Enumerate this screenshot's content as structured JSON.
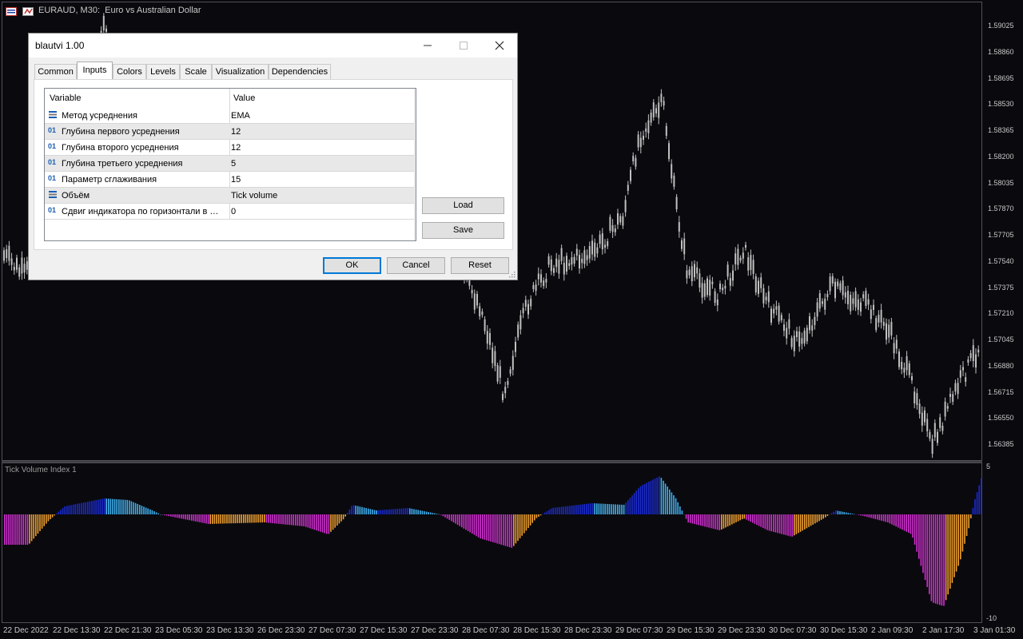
{
  "chart": {
    "symbol_title": "EURAUD, M30:  Euro vs Australian Dollar",
    "price_labels": [
      "1.59025",
      "1.58860",
      "1.58695",
      "1.58530",
      "1.58365",
      "1.58200",
      "1.58035",
      "1.57870",
      "1.57705",
      "1.57540",
      "1.57375",
      "1.57210",
      "1.57045",
      "1.56880",
      "1.56715",
      "1.56550",
      "1.56385"
    ],
    "time_labels": [
      "22 Dec 2022",
      "22 Dec 13:30",
      "22 Dec 21:30",
      "23 Dec 05:30",
      "23 Dec 13:30",
      "26 Dec 23:30",
      "27 Dec 07:30",
      "27 Dec 15:30",
      "27 Dec 23:30",
      "28 Dec 07:30",
      "28 Dec 15:30",
      "28 Dec 23:30",
      "29 Dec 07:30",
      "29 Dec 15:30",
      "29 Dec 23:30",
      "30 Dec 07:30",
      "30 Dec 15:30",
      "2 Jan 09:30",
      "2 Jan 17:30",
      "3 Jan 01:30"
    ],
    "subwindow_title": "Tick Volume Index 1",
    "subwindow_max": "5",
    "subwindow_min": "-10",
    "colors": {
      "background": "#0a0a0e",
      "candle": "#c0c0c0",
      "rising_strong": "#1a2ad0",
      "rising_weak": "#40b0f0",
      "falling_strong": "#d030d0",
      "falling_weak": "#f0a030"
    }
  },
  "dialog": {
    "title": "blautvi 1.00",
    "tabs": [
      "Common",
      "Inputs",
      "Colors",
      "Levels",
      "Scale",
      "Visualization",
      "Dependencies"
    ],
    "active_tab": "Inputs",
    "columns": {
      "variable": "Variable",
      "value": "Value"
    },
    "rows": [
      {
        "icon": "enum-icon",
        "name": "Метод усреднения",
        "value": "EMA"
      },
      {
        "icon": "int-icon",
        "name": "Глубина первого усреднения",
        "value": "12"
      },
      {
        "icon": "int-icon",
        "name": "Глубина второго усреднения",
        "value": "12"
      },
      {
        "icon": "int-icon",
        "name": "Глубина третьего усреднения",
        "value": "5"
      },
      {
        "icon": "int-icon",
        "name": "Параметр сглаживания",
        "value": "15"
      },
      {
        "icon": "enum-icon",
        "name": "Объём",
        "value": "Tick volume"
      },
      {
        "icon": "int-icon",
        "name": "Сдвиг индикатора по горизонтали в …",
        "value": "0"
      }
    ],
    "int_icon_text": "01",
    "buttons": {
      "load": "Load",
      "save": "Save",
      "ok": "OK",
      "cancel": "Cancel",
      "reset": "Reset"
    }
  }
}
